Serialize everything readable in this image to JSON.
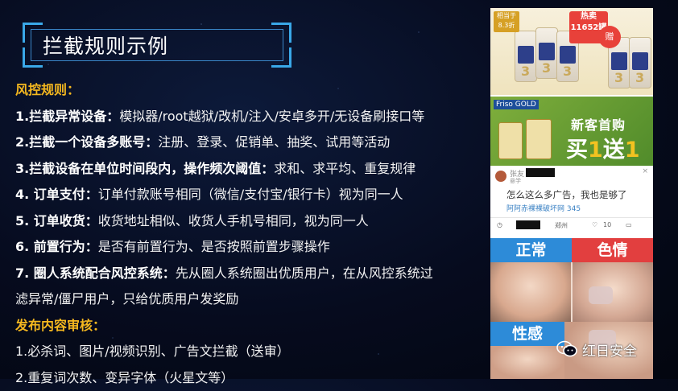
{
  "title": "拦截规则示例",
  "lines": [
    {
      "type": "heading",
      "text": "风控规则："
    },
    {
      "type": "item",
      "bold": "1.拦截异常设备：",
      "text": "模拟器/root越狱/改机/注入/安卓多开/无设备刷接口等"
    },
    {
      "type": "item",
      "bold": "2.拦截一个设备多账号：",
      "text": "注册、登录、促销单、抽奖、试用等活动"
    },
    {
      "type": "item",
      "bold": "3.拦截设备在单位时间段内，操作频次阈值：",
      "text": "求和、求平均、重复规律"
    },
    {
      "type": "item",
      "bold": "4. 订单支付：",
      "text": "订单付款账号相同（微信/支付宝/银行卡）视为同一人"
    },
    {
      "type": "item",
      "bold": "5. 订单收货：",
      "text": "收货地址相似、收货人手机号相同，视为同一人"
    },
    {
      "type": "item",
      "bold": "6. 前置行为：",
      "text": "是否有前置行为、是否按照前置步骤操作"
    },
    {
      "type": "item",
      "bold": "7. 圈人系统配合风控系统：",
      "text": "先从圈人系统圈出优质用户，在从风控系统过"
    },
    {
      "type": "plain",
      "text": "滤异常/僵尸用户，只给优质用户发奖励"
    },
    {
      "type": "heading",
      "text": "发布内容审核："
    },
    {
      "type": "plain",
      "text": "1.必杀词、图片/视频识别、广告文拦截（送审）"
    },
    {
      "type": "plain",
      "text": "2.重复词次数、变异字体（火星文等）"
    }
  ],
  "ads": {
    "ad1_tag": "相当于8.3折",
    "ad1_hot": "热卖11652罐",
    "ad1_gift": "赠",
    "ad1_can_number": "3",
    "ad2_logo": "Friso GOLD",
    "ad2_line1": "新客首购",
    "ad2_line2_a": "买",
    "ad2_line2_b": "1",
    "ad2_line2_c": "送",
    "ad2_line2_d": "1"
  },
  "feed": {
    "name": "张友",
    "level": "悬学",
    "message": "怎么这么多广告，我也是够了",
    "sub": "阿阿赤裸裸破坏网 345",
    "like_count": "10",
    "close": "×",
    "location": "郑州"
  },
  "grid": {
    "normal": "正常",
    "porn": "色情",
    "sexy": "性感"
  },
  "watermark": "红日安全",
  "colors": {
    "heading": "#f5b81f",
    "accent_blue": "#2d8bd8",
    "accent_red": "#e23f3f",
    "frame": "#3aa8e8"
  }
}
